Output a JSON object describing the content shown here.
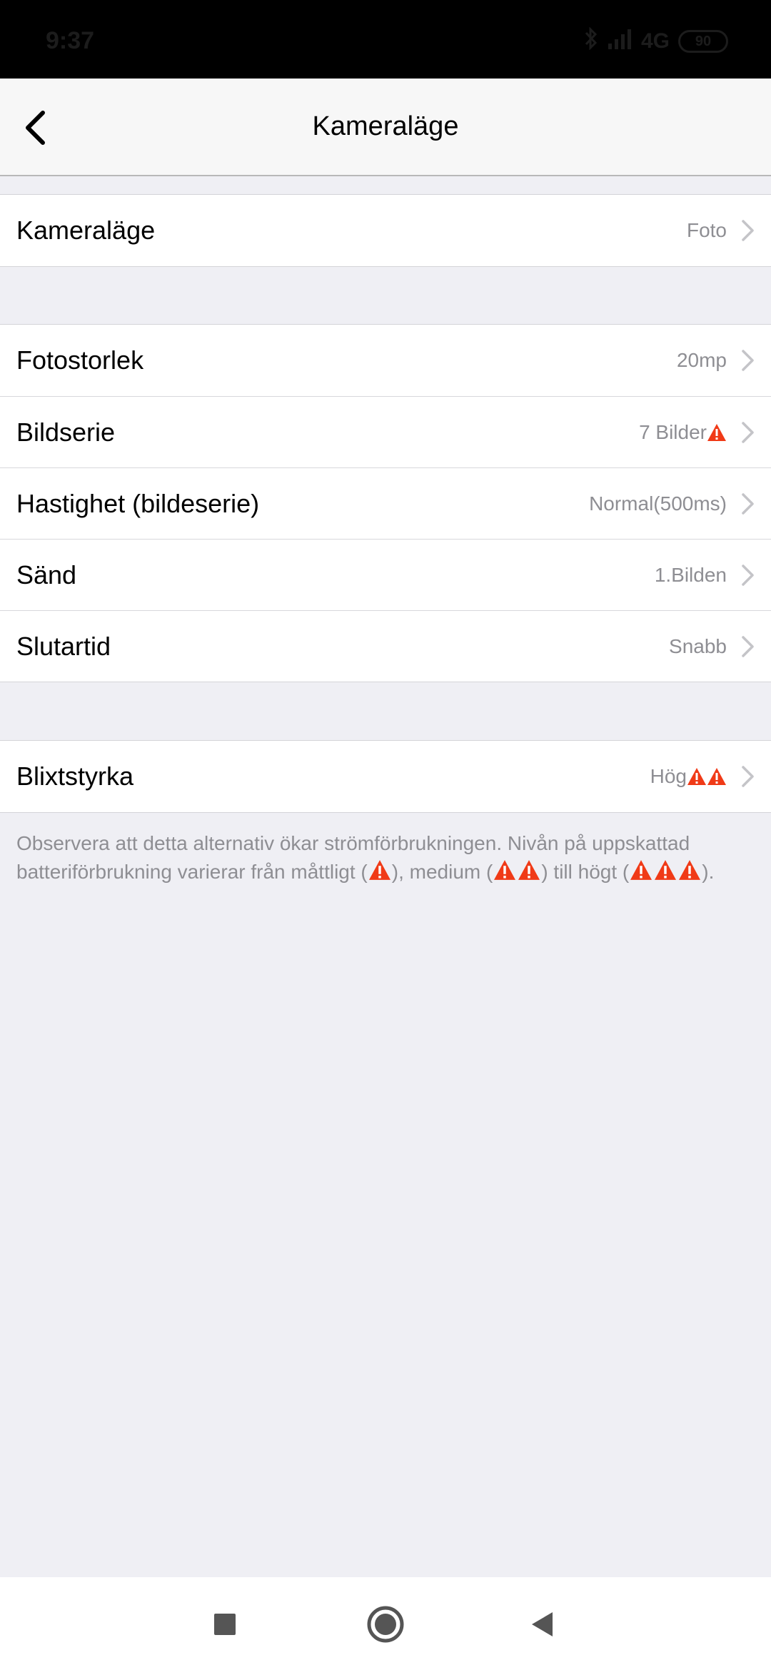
{
  "status": {
    "time": "9:37",
    "network": "4G",
    "battery": "90"
  },
  "header": {
    "title": "Kameraläge"
  },
  "groups": [
    {
      "rows": [
        {
          "label": "Kameraläge",
          "value": "Foto",
          "warnings": 0
        }
      ]
    },
    {
      "rows": [
        {
          "label": "Fotostorlek",
          "value": "20mp",
          "warnings": 0
        },
        {
          "label": "Bildserie",
          "value": "7 Bilder",
          "warnings": 1
        },
        {
          "label": "Hastighet (bildeserie)",
          "value": "Normal(500ms)",
          "warnings": 0
        },
        {
          "label": "Sänd",
          "value": "1.Bilden",
          "warnings": 0
        },
        {
          "label": "Slutartid",
          "value": "Snabb",
          "warnings": 0
        }
      ]
    },
    {
      "rows": [
        {
          "label": "Blixtstyrka",
          "value": "Hög",
          "warnings": 2
        }
      ]
    }
  ],
  "note": {
    "part1": "Observera att detta alternativ ökar strömförbrukningen. Nivån på uppskattad batteriförbrukning varierar från måttligt (",
    "part2": "), medium (",
    "part3": ") till högt (",
    "part4": ")."
  },
  "colors": {
    "warning": "#f03a17",
    "value_text": "#8e8e93",
    "background": "#efeff4"
  },
  "icons": {
    "back": "chevron-left-icon",
    "row_arrow": "chevron-right-icon",
    "warning": "warning-triangle-icon",
    "nav_recent": "square-icon",
    "nav_home": "circle-icon",
    "nav_back": "triangle-back-icon"
  }
}
